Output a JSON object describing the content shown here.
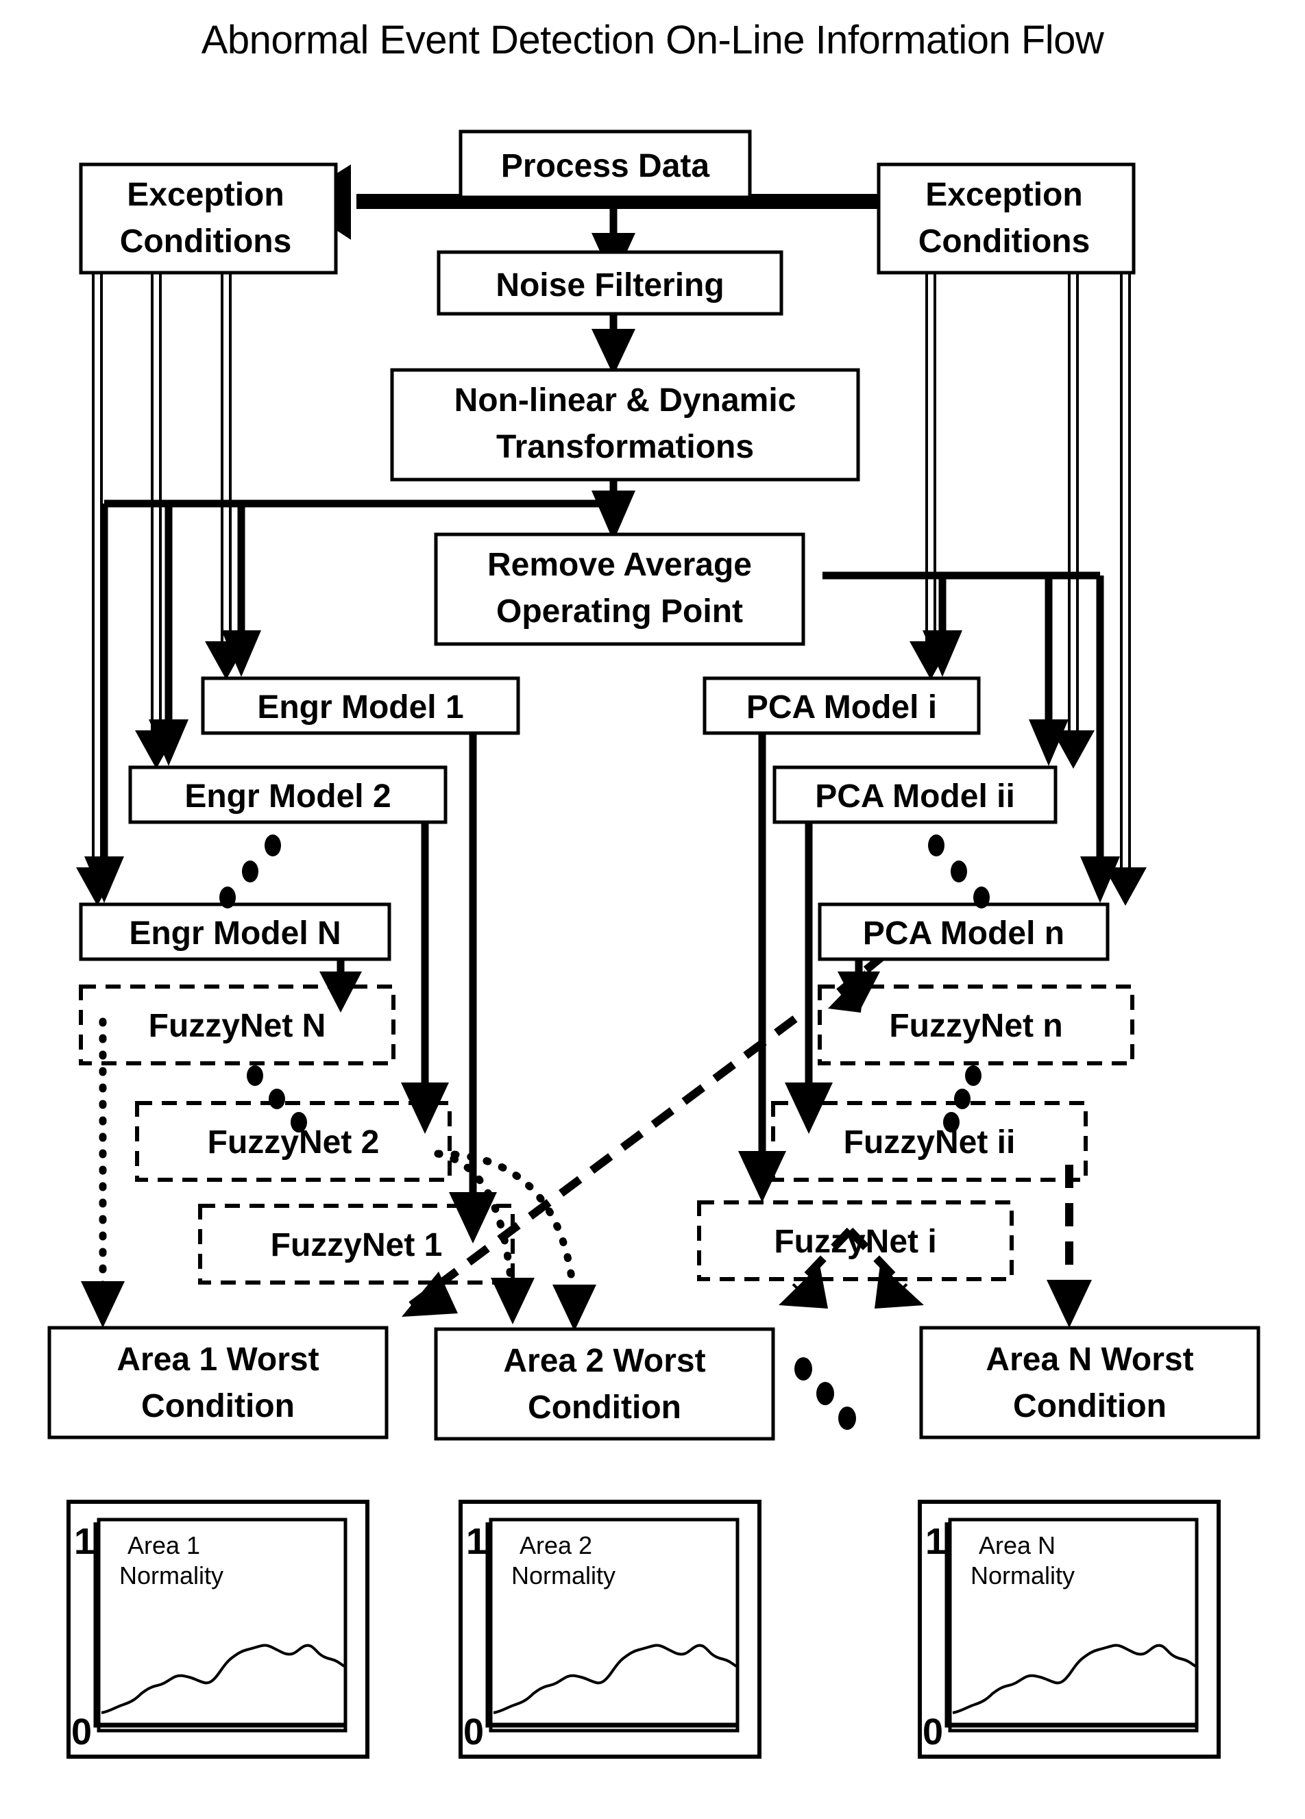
{
  "title": "Abnormal Event Detection On-Line Information Flow",
  "nodes": {
    "process_data": "Process Data",
    "noise_filtering": "Noise Filtering",
    "nonlinear_line1": "Non-linear & Dynamic",
    "nonlinear_line2": "Transformations",
    "remove_avg_line1": "Remove Average",
    "remove_avg_line2": "Operating Point",
    "exception_left_line1": "Exception",
    "exception_left_line2": "Conditions",
    "exception_right_line1": "Exception",
    "exception_right_line2": "Conditions"
  },
  "engr_models": [
    "Engr Model 1",
    "Engr Model 2",
    "Engr Model N"
  ],
  "pca_models": [
    "PCA Model i",
    "PCA Model ii",
    "PCA Model n"
  ],
  "fuzzynets_left": [
    "FuzzyNet N",
    "FuzzyNet 2",
    "FuzzyNet 1"
  ],
  "fuzzynets_right": [
    "FuzzyNet n",
    "FuzzyNet ii",
    "FuzzyNet i"
  ],
  "worst_conditions": [
    {
      "line1": "Area 1 Worst",
      "line2": "Condition"
    },
    {
      "line1": "Area 2 Worst",
      "line2": "Condition"
    },
    {
      "line1": "Area N Worst",
      "line2": "Condition"
    }
  ],
  "charts": [
    {
      "label_line1": "Area 1",
      "label_line2": "Normality",
      "y_top": "1",
      "y_bottom": "0"
    },
    {
      "label_line1": "Area 2",
      "label_line2": "Normality",
      "y_top": "1",
      "y_bottom": "0"
    },
    {
      "label_line1": "Area N",
      "label_line2": "Normality",
      "y_top": "1",
      "y_bottom": "0"
    }
  ],
  "chart_data": {
    "type": "line",
    "title": "Area Normality trend (repeated for Area 1, Area 2, Area N)",
    "xlabel": "",
    "ylabel": "Normality",
    "ylim": [
      0,
      1
    ],
    "ytick_labels": [
      "0",
      "1"
    ],
    "grid": false,
    "legend": "none",
    "x": [
      0,
      1,
      2,
      3,
      4,
      5,
      6,
      7,
      8,
      9,
      10,
      11,
      12,
      13,
      14,
      15,
      16,
      17,
      18,
      19,
      20,
      21,
      22,
      23,
      24,
      25,
      26,
      27,
      28,
      29,
      30
    ],
    "series": [
      {
        "name": "Normality",
        "values": [
          0.1,
          0.11,
          0.13,
          0.13,
          0.17,
          0.21,
          0.24,
          0.25,
          0.28,
          0.31,
          0.31,
          0.28,
          0.25,
          0.31,
          0.4,
          0.45,
          0.47,
          0.5,
          0.48,
          0.44,
          0.41,
          0.42,
          0.4,
          0.44,
          0.47,
          0.44,
          0.42,
          0.44,
          0.46,
          0.42,
          0.38
        ]
      }
    ]
  },
  "accent_color": "#000000",
  "background_color": "#ffffff"
}
